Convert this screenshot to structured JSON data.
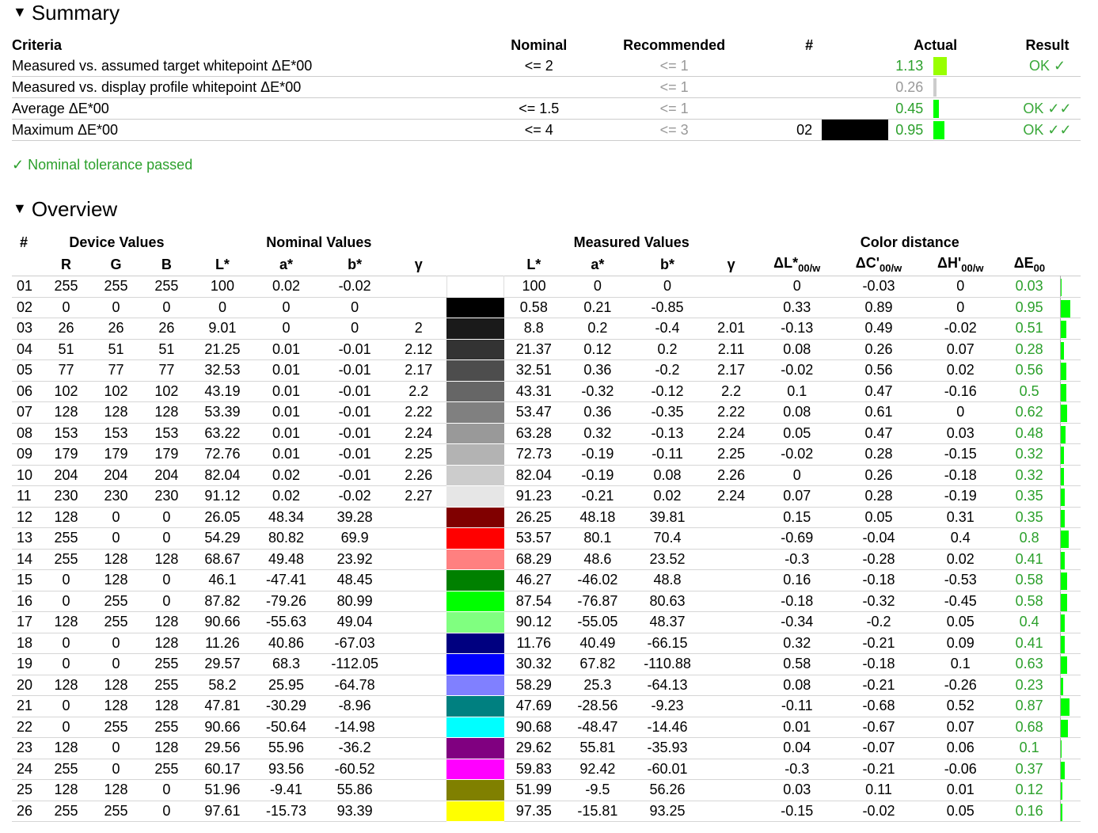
{
  "summary": {
    "title": "Summary",
    "headers": {
      "criteria": "Criteria",
      "nominal": "Nominal",
      "recommended": "Recommended",
      "hash": "#",
      "actual": "Actual",
      "result": "Result"
    },
    "rows": [
      {
        "criteria": "Measured vs. assumed target whitepoint ΔE*00",
        "nominal": "<= 2",
        "recommended": "<= 1",
        "hash": "",
        "actual": "1.13",
        "result": "OK ✓",
        "bar_fraction": 0.57,
        "bar_color": "#99ff00",
        "actual_color": "green"
      },
      {
        "criteria": "Measured vs. display profile whitepoint ΔE*00",
        "nominal": "",
        "recommended": "<= 1",
        "hash": "",
        "actual": "0.26",
        "result": "",
        "bar_fraction": 0.13,
        "bar_color": "#cccccc",
        "actual_color": "gray"
      },
      {
        "criteria": "Average ΔE*00",
        "nominal": "<= 1.5",
        "recommended": "<= 1",
        "hash": "",
        "actual": "0.45",
        "result": "OK ✓✓",
        "bar_fraction": 0.22,
        "bar_color": "#00ff00",
        "actual_color": "green"
      },
      {
        "criteria": "Maximum ΔE*00",
        "nominal": "<= 4",
        "recommended": "<= 3",
        "hash": "02",
        "actual": "0.95",
        "result": "OK ✓✓",
        "bar_fraction": 0.47,
        "bar_color": "#00ff00",
        "actual_color": "green",
        "swatch": "#000000"
      }
    ],
    "pass_message": "✓ Nominal tolerance passed"
  },
  "overview": {
    "title": "Overview",
    "group_headers": {
      "hash": "#",
      "device": "Device Values",
      "nominal": "Nominal Values",
      "measured": "Measured Values",
      "distance": "Color distance"
    },
    "col_headers": [
      "R",
      "G",
      "B",
      "L*",
      "a*",
      "b*",
      "γ",
      "L*",
      "a*",
      "b*",
      "γ"
    ],
    "dist_headers": {
      "dl": "ΔL*",
      "dc": "ΔC'",
      "dh": "ΔH'",
      "de": "ΔE",
      "sub_w": "00/w",
      "sub": "00"
    },
    "rows": [
      {
        "n": "01",
        "r": "255",
        "g": "255",
        "b": "255",
        "nl": "100",
        "na": "0.02",
        "nb": "-0.02",
        "ng": "",
        "color": "#ffffff",
        "ml": "100",
        "ma": "0",
        "mb": "0",
        "mg": "",
        "dl": "0",
        "dc": "-0.03",
        "dh": "0",
        "de": "0.03",
        "de_val": 0.03
      },
      {
        "n": "02",
        "r": "0",
        "g": "0",
        "b": "0",
        "nl": "0",
        "na": "0",
        "nb": "0",
        "ng": "",
        "color": "#000000",
        "ml": "0.58",
        "ma": "0.21",
        "mb": "-0.85",
        "mg": "",
        "dl": "0.33",
        "dc": "0.89",
        "dh": "0",
        "de": "0.95",
        "de_val": 0.95
      },
      {
        "n": "03",
        "r": "26",
        "g": "26",
        "b": "26",
        "nl": "9.01",
        "na": "0",
        "nb": "0",
        "ng": "2",
        "color": "#1a1a1a",
        "ml": "8.8",
        "ma": "0.2",
        "mb": "-0.4",
        "mg": "2.01",
        "dl": "-0.13",
        "dc": "0.49",
        "dh": "-0.02",
        "de": "0.51",
        "de_val": 0.51
      },
      {
        "n": "04",
        "r": "51",
        "g": "51",
        "b": "51",
        "nl": "21.25",
        "na": "0.01",
        "nb": "-0.01",
        "ng": "2.12",
        "color": "#333333",
        "ml": "21.37",
        "ma": "0.12",
        "mb": "0.2",
        "mg": "2.11",
        "dl": "0.08",
        "dc": "0.26",
        "dh": "0.07",
        "de": "0.28",
        "de_val": 0.28
      },
      {
        "n": "05",
        "r": "77",
        "g": "77",
        "b": "77",
        "nl": "32.53",
        "na": "0.01",
        "nb": "-0.01",
        "ng": "2.17",
        "color": "#4d4d4d",
        "ml": "32.51",
        "ma": "0.36",
        "mb": "-0.2",
        "mg": "2.17",
        "dl": "-0.02",
        "dc": "0.56",
        "dh": "0.02",
        "de": "0.56",
        "de_val": 0.56
      },
      {
        "n": "06",
        "r": "102",
        "g": "102",
        "b": "102",
        "nl": "43.19",
        "na": "0.01",
        "nb": "-0.01",
        "ng": "2.2",
        "color": "#666666",
        "ml": "43.31",
        "ma": "-0.32",
        "mb": "-0.12",
        "mg": "2.2",
        "dl": "0.1",
        "dc": "0.47",
        "dh": "-0.16",
        "de": "0.5",
        "de_val": 0.5
      },
      {
        "n": "07",
        "r": "128",
        "g": "128",
        "b": "128",
        "nl": "53.39",
        "na": "0.01",
        "nb": "-0.01",
        "ng": "2.22",
        "color": "#808080",
        "ml": "53.47",
        "ma": "0.36",
        "mb": "-0.35",
        "mg": "2.22",
        "dl": "0.08",
        "dc": "0.61",
        "dh": "0",
        "de": "0.62",
        "de_val": 0.62
      },
      {
        "n": "08",
        "r": "153",
        "g": "153",
        "b": "153",
        "nl": "63.22",
        "na": "0.01",
        "nb": "-0.01",
        "ng": "2.24",
        "color": "#999999",
        "ml": "63.28",
        "ma": "0.32",
        "mb": "-0.13",
        "mg": "2.24",
        "dl": "0.05",
        "dc": "0.47",
        "dh": "0.03",
        "de": "0.48",
        "de_val": 0.48
      },
      {
        "n": "09",
        "r": "179",
        "g": "179",
        "b": "179",
        "nl": "72.76",
        "na": "0.01",
        "nb": "-0.01",
        "ng": "2.25",
        "color": "#b3b3b3",
        "ml": "72.73",
        "ma": "-0.19",
        "mb": "-0.11",
        "mg": "2.25",
        "dl": "-0.02",
        "dc": "0.28",
        "dh": "-0.15",
        "de": "0.32",
        "de_val": 0.32
      },
      {
        "n": "10",
        "r": "204",
        "g": "204",
        "b": "204",
        "nl": "82.04",
        "na": "0.02",
        "nb": "-0.01",
        "ng": "2.26",
        "color": "#cccccc",
        "ml": "82.04",
        "ma": "-0.19",
        "mb": "0.08",
        "mg": "2.26",
        "dl": "0",
        "dc": "0.26",
        "dh": "-0.18",
        "de": "0.32",
        "de_val": 0.32
      },
      {
        "n": "11",
        "r": "230",
        "g": "230",
        "b": "230",
        "nl": "91.12",
        "na": "0.02",
        "nb": "-0.02",
        "ng": "2.27",
        "color": "#e6e6e6",
        "ml": "91.23",
        "ma": "-0.21",
        "mb": "0.02",
        "mg": "2.24",
        "dl": "0.07",
        "dc": "0.28",
        "dh": "-0.19",
        "de": "0.35",
        "de_val": 0.35
      },
      {
        "n": "12",
        "r": "128",
        "g": "0",
        "b": "0",
        "nl": "26.05",
        "na": "48.34",
        "nb": "39.28",
        "ng": "",
        "color": "#800000",
        "ml": "26.25",
        "ma": "48.18",
        "mb": "39.81",
        "mg": "",
        "dl": "0.15",
        "dc": "0.05",
        "dh": "0.31",
        "de": "0.35",
        "de_val": 0.35
      },
      {
        "n": "13",
        "r": "255",
        "g": "0",
        "b": "0",
        "nl": "54.29",
        "na": "80.82",
        "nb": "69.9",
        "ng": "",
        "color": "#ff0000",
        "ml": "53.57",
        "ma": "80.1",
        "mb": "70.4",
        "mg": "",
        "dl": "-0.69",
        "dc": "-0.04",
        "dh": "0.4",
        "de": "0.8",
        "de_val": 0.8
      },
      {
        "n": "14",
        "r": "255",
        "g": "128",
        "b": "128",
        "nl": "68.67",
        "na": "49.48",
        "nb": "23.92",
        "ng": "",
        "color": "#ff8080",
        "ml": "68.29",
        "ma": "48.6",
        "mb": "23.52",
        "mg": "",
        "dl": "-0.3",
        "dc": "-0.28",
        "dh": "0.02",
        "de": "0.41",
        "de_val": 0.41
      },
      {
        "n": "15",
        "r": "0",
        "g": "128",
        "b": "0",
        "nl": "46.1",
        "na": "-47.41",
        "nb": "48.45",
        "ng": "",
        "color": "#008000",
        "ml": "46.27",
        "ma": "-46.02",
        "mb": "48.8",
        "mg": "",
        "dl": "0.16",
        "dc": "-0.18",
        "dh": "-0.53",
        "de": "0.58",
        "de_val": 0.58
      },
      {
        "n": "16",
        "r": "0",
        "g": "255",
        "b": "0",
        "nl": "87.82",
        "na": "-79.26",
        "nb": "80.99",
        "ng": "",
        "color": "#00ff00",
        "ml": "87.54",
        "ma": "-76.87",
        "mb": "80.63",
        "mg": "",
        "dl": "-0.18",
        "dc": "-0.32",
        "dh": "-0.45",
        "de": "0.58",
        "de_val": 0.58
      },
      {
        "n": "17",
        "r": "128",
        "g": "255",
        "b": "128",
        "nl": "90.66",
        "na": "-55.63",
        "nb": "49.04",
        "ng": "",
        "color": "#80ff80",
        "ml": "90.12",
        "ma": "-55.05",
        "mb": "48.37",
        "mg": "",
        "dl": "-0.34",
        "dc": "-0.2",
        "dh": "0.05",
        "de": "0.4",
        "de_val": 0.4
      },
      {
        "n": "18",
        "r": "0",
        "g": "0",
        "b": "128",
        "nl": "11.26",
        "na": "40.86",
        "nb": "-67.03",
        "ng": "",
        "color": "#000080",
        "ml": "11.76",
        "ma": "40.49",
        "mb": "-66.15",
        "mg": "",
        "dl": "0.32",
        "dc": "-0.21",
        "dh": "0.09",
        "de": "0.41",
        "de_val": 0.41
      },
      {
        "n": "19",
        "r": "0",
        "g": "0",
        "b": "255",
        "nl": "29.57",
        "na": "68.3",
        "nb": "-112.05",
        "ng": "",
        "color": "#0000ff",
        "ml": "30.32",
        "ma": "67.82",
        "mb": "-110.88",
        "mg": "",
        "dl": "0.58",
        "dc": "-0.18",
        "dh": "0.1",
        "de": "0.63",
        "de_val": 0.63
      },
      {
        "n": "20",
        "r": "128",
        "g": "128",
        "b": "255",
        "nl": "58.2",
        "na": "25.95",
        "nb": "-64.78",
        "ng": "",
        "color": "#8080ff",
        "ml": "58.29",
        "ma": "25.3",
        "mb": "-64.13",
        "mg": "",
        "dl": "0.08",
        "dc": "-0.21",
        "dh": "-0.26",
        "de": "0.23",
        "de_val": 0.23
      },
      {
        "n": "21",
        "r": "0",
        "g": "128",
        "b": "128",
        "nl": "47.81",
        "na": "-30.29",
        "nb": "-8.96",
        "ng": "",
        "color": "#008080",
        "ml": "47.69",
        "ma": "-28.56",
        "mb": "-9.23",
        "mg": "",
        "dl": "-0.11",
        "dc": "-0.68",
        "dh": "0.52",
        "de": "0.87",
        "de_val": 0.87
      },
      {
        "n": "22",
        "r": "0",
        "g": "255",
        "b": "255",
        "nl": "90.66",
        "na": "-50.64",
        "nb": "-14.98",
        "ng": "",
        "color": "#00ffff",
        "ml": "90.68",
        "ma": "-48.47",
        "mb": "-14.46",
        "mg": "",
        "dl": "0.01",
        "dc": "-0.67",
        "dh": "0.07",
        "de": "0.68",
        "de_val": 0.68
      },
      {
        "n": "23",
        "r": "128",
        "g": "0",
        "b": "128",
        "nl": "29.56",
        "na": "55.96",
        "nb": "-36.2",
        "ng": "",
        "color": "#800080",
        "ml": "29.62",
        "ma": "55.81",
        "mb": "-35.93",
        "mg": "",
        "dl": "0.04",
        "dc": "-0.07",
        "dh": "0.06",
        "de": "0.1",
        "de_val": 0.1
      },
      {
        "n": "24",
        "r": "255",
        "g": "0",
        "b": "255",
        "nl": "60.17",
        "na": "93.56",
        "nb": "-60.52",
        "ng": "",
        "color": "#ff00ff",
        "ml": "59.83",
        "ma": "92.42",
        "mb": "-60.01",
        "mg": "",
        "dl": "-0.3",
        "dc": "-0.21",
        "dh": "-0.06",
        "de": "0.37",
        "de_val": 0.37
      },
      {
        "n": "25",
        "r": "128",
        "g": "128",
        "b": "0",
        "nl": "51.96",
        "na": "-9.41",
        "nb": "55.86",
        "ng": "",
        "color": "#808000",
        "ml": "51.99",
        "ma": "-9.5",
        "mb": "56.26",
        "mg": "",
        "dl": "0.03",
        "dc": "0.11",
        "dh": "0.01",
        "de": "0.12",
        "de_val": 0.12
      },
      {
        "n": "26",
        "r": "255",
        "g": "255",
        "b": "0",
        "nl": "97.61",
        "na": "-15.73",
        "nb": "93.39",
        "ng": "",
        "color": "#ffff00",
        "ml": "97.35",
        "ma": "-15.81",
        "mb": "93.25",
        "mg": "",
        "dl": "-0.15",
        "dc": "-0.02",
        "dh": "0.05",
        "de": "0.16",
        "de_val": 0.16
      }
    ]
  }
}
